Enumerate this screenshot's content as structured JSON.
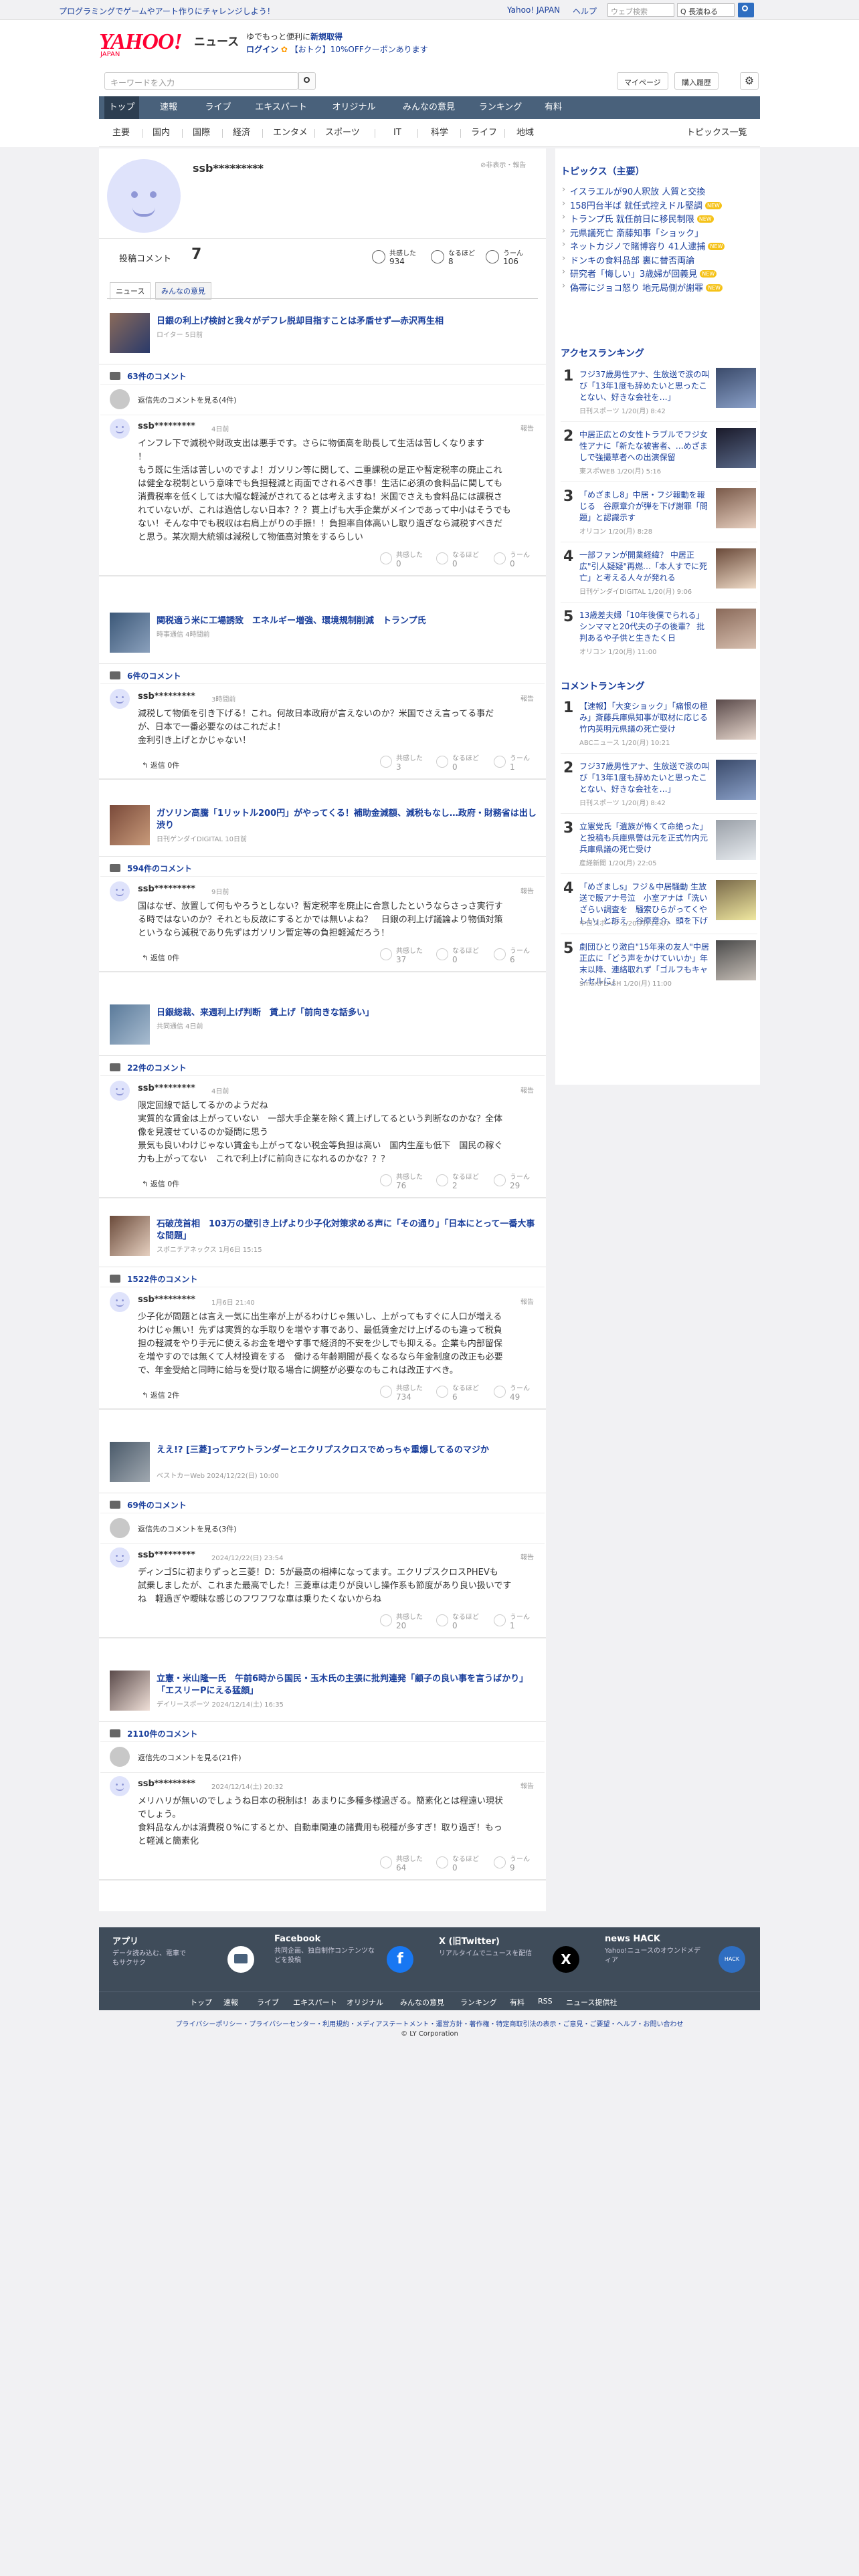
{
  "topbar": {
    "promo": "プログラミングでゲームやアート作りにチャレンジしよう！",
    "links": [
      "Yahoo! JAPAN",
      "ヘルプ"
    ],
    "search_placeholder": "ウェブ検索",
    "select": "Q 長濱ねる"
  },
  "header": {
    "logo": "YAHOO!",
    "logo_sub": "JAPAN",
    "news": "ニュース",
    "promo1": "ゆでもっと便利に",
    "promo1b": "新規取得",
    "promo2": "ログイン",
    "promo3": "【おトク】10%OFFクーポンあります"
  },
  "search": {
    "placeholder": "キーワードを入力",
    "mypage": "マイページ",
    "purchased": "購入履歴"
  },
  "mainnav": [
    "トップ",
    "速報",
    "ライブ",
    "エキスパート",
    "オリジナル",
    "みんなの意見",
    "ランキング",
    "有料"
  ],
  "subnav": [
    "主要",
    "国内",
    "国際",
    "経済",
    "エンタメ",
    "スポーツ",
    "IT",
    "科学",
    "ライフ",
    "地域"
  ],
  "subnav_right": "トピックス一覧",
  "profile": {
    "name": "ssb*********",
    "hidden": "非表示・報告",
    "post_label": "投稿コメント",
    "post_count": "7",
    "stats": [
      {
        "label": "共感した",
        "value": "934"
      },
      {
        "label": "なるほど",
        "value": "8"
      },
      {
        "label": "うーん",
        "value": "106"
      }
    ],
    "tabs": [
      "ニュース",
      "みんなの意見"
    ]
  },
  "see_replies_label": "返信先のコメントを見る",
  "reply_label": "返信",
  "report_label": "報告",
  "entries": [
    {
      "title": "日銀の利上げ検討と我々がデフレ脱却目指すことは矛盾せず―赤沢再生相",
      "source": "ロイター 5日前",
      "count": "63件のコメント",
      "see": "返信先のコメントを見る(4件)",
      "user": "ssb*********",
      "time": "4日前",
      "text": [
        "インフレ下で減税や財政支出は悪手です。さらに物価高を助長して生活は苦しくなります",
        "！",
        "もう既に生活は苦しいのですよ！ガソリン等に関して、二重課税の是正や暫定税率の廃止これ",
        "は健全な税制という意味でも負担軽減と両面でされるべき事！生活に必須の食料品に関しても",
        "消費税率を低くしては大幅な軽減がされてるとは考えますね！米国でさえも食料品には課税さ",
        "れていないが、これは過信しない日本？？？貰上げも大手企業がメインであって中小はそうでも",
        "ない！そんな中でも税収は右肩上がりの手振！！負担率自体高いし取り過ぎなら減税すべきだ",
        "と思う。某次期大統領は減税して物価高対策をするらしい"
      ],
      "r": [
        "0",
        "0",
        "0"
      ],
      "replies": ""
    },
    {
      "title": "関税適う米に工場誘致　エネルギー増強、環境規制削減　トランプ氏",
      "source": "時事通信 4時間前",
      "count": "6件のコメント",
      "see": "",
      "user": "ssb*********",
      "time": "3時間前",
      "text": [
        "減税して物価を引き下げる！これ。何故日本政府が言えないのか？米国でさえ言ってる事だ",
        "が、日本で一番必要なのはこれだよ！",
        "金利引き上げとかじゃない！"
      ],
      "r": [
        "3",
        "0",
        "1"
      ],
      "replies": "返信 0件"
    },
    {
      "title": "ガソリン高騰「1リットル200円」がやってくる！補助金減額、減税もなし…政府・財務省は出し渋り",
      "source": "日刊ゲンダイDIGITAL 10日前",
      "count": "594件のコメント",
      "see": "",
      "user": "ssb*********",
      "time": "9日前",
      "text": [
        "国はなぜ、放置して何もやろうとしない？暫定税率を廃止に合意したというならさっさ実行す",
        "る時ではないのか？それとも反故にするとかでは無いよね？　日銀の利上げ議論より物価対策",
        "というなら減税であり先ずはガソリン暫定等の負担軽減だろう！"
      ],
      "r": [
        "37",
        "0",
        "6"
      ],
      "replies": "返信 0件"
    },
    {
      "title": "日銀総裁、来週利上げ判断　賃上げ「前向きな話多い」",
      "source": "共同通信 4日前",
      "count": "22件のコメント",
      "see": "",
      "user": "ssb*********",
      "time": "4日前",
      "text": [
        "限定回線で話してるかのようだね",
        "実質的な賃金は上がっていない　一部大手企業を除く賃上げしてるという判断なのかな？全体",
        "像を見渡せているのか疑問に思う",
        "景気も良いわけじゃない賃金も上がってない税金等負担は高い　国内生産も低下　国民の稼ぐ",
        "力も上がってない　これで利上げに前向きになれるのかな？？？"
      ],
      "r": [
        "76",
        "2",
        "29"
      ],
      "replies": "返信 0件"
    },
    {
      "title": "石破茂首相　103万の壁引き上げより少子化対策求める声に「その通り」「日本にとって一番大事な問題」",
      "source": "スポニチアネックス 1月6日 15:15",
      "count": "1522件のコメント",
      "see": "",
      "user": "ssb*********",
      "time": "1月6日 21:40",
      "text": [
        "少子化が問題とは言え一気に出生率が上がるわけじゃ無いし、上がってもすぐに人口が増える",
        "わけじゃ無い！先ずは実質的な手取りを増やす事であり、最低賃金だけ上げるのも違って税負",
        "担の軽減をやり手元に使えるお金を増やす事で経済的不安を少しでも抑える。企業も内部留保",
        "を増やすのでは無くて人材投資をする　働ける年齢期間が長くなるなら年金制度の改正も必要",
        "で、年金受給と同時に給与を受け取る場合に調整が必要なのもこれは改正すべき。"
      ],
      "r": [
        "734",
        "6",
        "49"
      ],
      "replies": "返信 2件"
    },
    {
      "title": "ええ!? [三菱]ってアウトランダーとエクリプスクロスでめっちゃ重爆してるのマジか",
      "source": "ベストカーWeb 2024/12/22(日) 10:00",
      "count": "69件のコメント",
      "see": "返信先のコメントを見る(3件)",
      "user": "ssb*********",
      "time": "2024/12/22(日) 23:54",
      "text": [
        "ディンゴSに初まりずっと三菱！D：5が最高の相棒になってます。エクリプスクロスPHEVも",
        "試乗しましたが、これまた最高でした！三菱車は走りが良いし操作系も節度があり良い扱いです",
        "ね　軽過ぎや曖昧な感じのフワフワな車は乗りたくないからね"
      ],
      "r": [
        "20",
        "0",
        "1"
      ],
      "replies": ""
    },
    {
      "title": "立憲・米山隆一氏　午前6時から国民・玉木氏の主張に批判連発「顧子の良い事を言うばかり」「エスリーPにえる猛顔」",
      "source": "デイリースポーツ 2024/12/14(土) 16:35",
      "count": "2110件のコメント",
      "see": "返信先のコメントを見る(21件)",
      "user": "ssb*********",
      "time": "2024/12/14(土) 20:32",
      "text": [
        "メリハリが無いのでしょうね日本の税制は！あまりに多種多様過ぎる。簡素化とは程遠い現状",
        "でしょう。",
        "食料品なんかは消費税０%にするとか、自動車関連の諸費用も税種が多すぎ！取り過ぎ！もっ",
        "と軽減と簡素化"
      ],
      "r": [
        "64",
        "0",
        "9"
      ],
      "replies": ""
    }
  ],
  "react_labels": [
    "共感した",
    "なるほど",
    "うーん"
  ],
  "topics": {
    "heading": "トピックス（主要）",
    "items": [
      {
        "text": "イスラエルが90人釈放 人質と交換",
        "new": ""
      },
      {
        "text": "158円台半ば 就任式控えドル堅調",
        "new": "NEW"
      },
      {
        "text": "トランプ氏 就任前日に移民制限",
        "new": "NEW"
      },
      {
        "text": "元県議死亡 斎藤知事「ショック」",
        "new": ""
      },
      {
        "text": "ネットカジノで賭博容り 41人逮捕",
        "new": "NEW"
      },
      {
        "text": "ドンキの食料品部 裏に替否両論",
        "new": ""
      },
      {
        "text": "研究者「悔しい」3歳婦が回義見",
        "new": "NEW"
      },
      {
        "text": "偽帯にジョコ怒り 地元局側が謝罪",
        "new": "NEW"
      }
    ]
  },
  "access_ranking": {
    "heading": "アクセスランキング",
    "items": [
      {
        "num": "1",
        "title": "フジ37歳男性アナ、生放送で涙の叫び「13年1度も辞めたいと思ったことない、好きな会社を…」",
        "src": "日刊スポーツ 1/20(月) 8:42"
      },
      {
        "num": "2",
        "title": "中居正広との女性トラブルでフジ女性アナに「新たな被害者、…めざましで強撮草者への出演保留",
        "src": "東スポWEB 1/20(月) 5:16"
      },
      {
        "num": "3",
        "title": "「めざまし8」中居・フジ報動を報じる　谷原章介が弾を下げ謝罪「問題」と認識示す",
        "src": "オリコン 1/20(月) 8:28"
      },
      {
        "num": "4",
        "title": "一部ファンが開業経緯？ 中居正広\"引人疑疑\"再燃…「本人すでに死亡」と考える人々が発れる",
        "src": "日刊ゲンダイDIGITAL 1/20(月) 9:06"
      },
      {
        "num": "5",
        "title": "13歳差夫婦「10年後僕でられる」シンママと20代夫の子の後輩？ 批判あるや子供と生きたく日",
        "src": "オリコン 1/20(月) 11:00"
      }
    ]
  },
  "comment_ranking": {
    "heading": "コメントランキング",
    "items": [
      {
        "num": "1",
        "title": "【速報】「大変ショック」「痛恨の極み」斎藤兵庫県知事が取材に応じる　竹内英明元県議の死亡受け",
        "src": "ABCニュース 1/20(月) 10:21"
      },
      {
        "num": "2",
        "title": "フジ37歳男性アナ、生放送で涙の叫び「13年1度も辞めたいと思ったことない、好きな会社を…」",
        "src": "日刊スポーツ 1/20(月) 8:42"
      },
      {
        "num": "3",
        "title": "立憲党氏「遺族が怖くて命絶った」と投稿も兵庫県警は元を正式竹内元兵庫県議の死亡受け",
        "src": "産経新聞 1/20(月) 22:05"
      },
      {
        "num": "4",
        "title": "「めざましs」フジ＆中居騒動 生放送で販アナ号泣　小室アナは「洗いざらい調査を　騒索ひらがってくやしい」と訴え　谷原章介、頭を下げ謝罪",
        "src": "中日スポーツ 1/20(月) 11:07"
      },
      {
        "num": "5",
        "title": "劇団ひとり激白\"15年来の友人\"中居正広に「どう声をかけていいか」年末以降、連絡取れず「ゴルフもキャンセルに」",
        "src": "SmartFLASH 1/20(月) 11:00"
      }
    ]
  },
  "footer": {
    "items": [
      {
        "title": "アプリ",
        "desc": "データ読み込む、電車でもサクサク"
      },
      {
        "title": "Facebook",
        "desc": "共同企画、独自制作コンテンツなどを投稿"
      },
      {
        "title": "X (旧Twitter)",
        "desc": "リアルタイムでニュースを配信"
      },
      {
        "title": "news HACK",
        "desc": "Yahoo!ニュースのオウンドメディア"
      }
    ],
    "links": [
      "トップ",
      "速報",
      "ライブ",
      "エキスパート",
      "オリジナル",
      "みんなの意見",
      "ランキング",
      "有料",
      "RSS",
      "ニュース提供社"
    ],
    "legal": "プライバシーポリシー・プライバシーセンター・利用規約・メディアステートメント・運営方針・著作権・特定商取引法の表示・ご意見・ご要望・ヘルプ・お問い合わせ",
    "copyright": "© LY Corporation"
  }
}
